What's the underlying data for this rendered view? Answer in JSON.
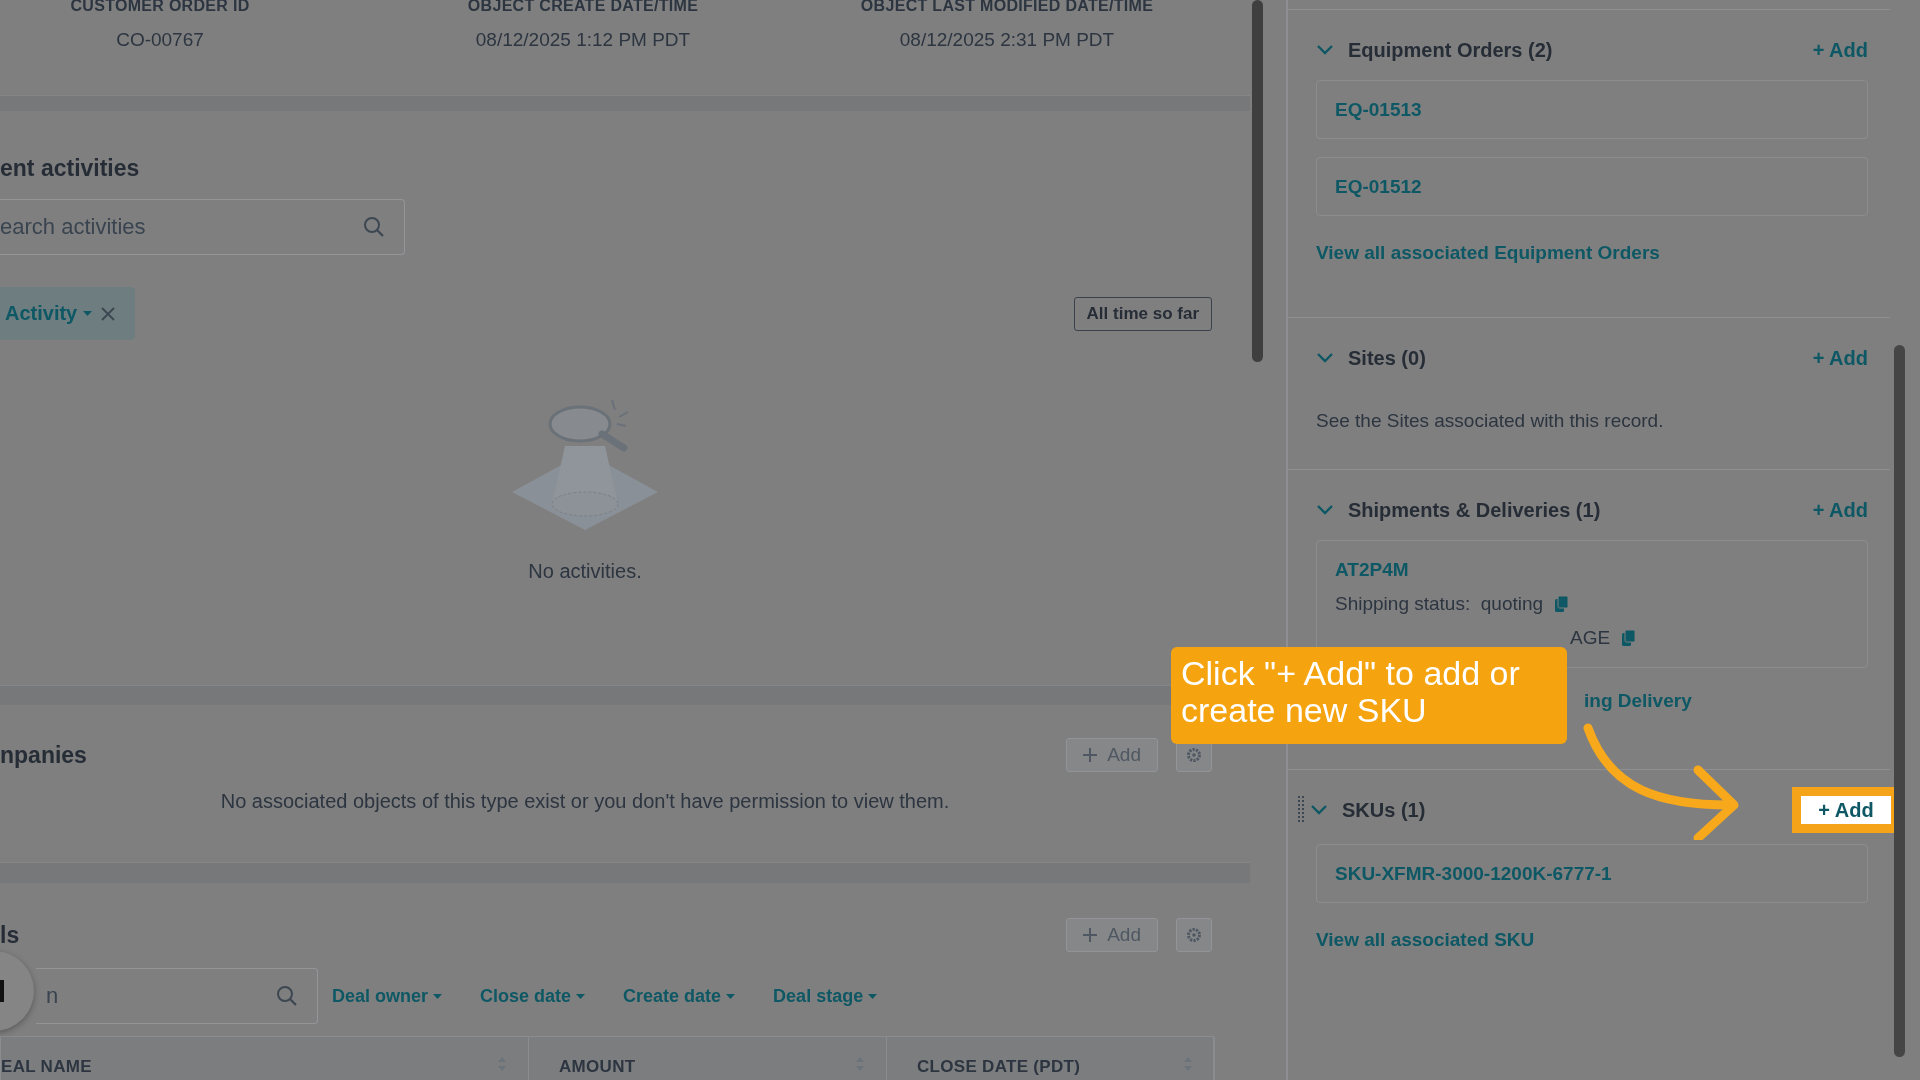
{
  "record_header": {
    "fields": [
      {
        "label": "CUSTOMER ORDER ID",
        "value": "CO-00767"
      },
      {
        "label": "OBJECT CREATE DATE/TIME",
        "value": "08/12/2025 1:12 PM PDT"
      },
      {
        "label": "OBJECT LAST MODIFIED DATE/TIME",
        "value": "08/12/2025 2:31 PM PDT"
      }
    ]
  },
  "activities": {
    "title": "ent activities",
    "search": {
      "placeholder": "earch activities"
    },
    "filter_chip": "Activity",
    "date_range_button": "All time so far",
    "empty_message": "No activities."
  },
  "companies": {
    "title": "npanies",
    "add_button": "Add",
    "empty_message": "No associated objects of this type exist or you don't have permission to view them."
  },
  "deals": {
    "title": "ls",
    "add_button": "Add",
    "search": {
      "placeholder": "n"
    },
    "filters": [
      "Deal owner",
      "Close date",
      "Create date",
      "Deal stage"
    ],
    "columns": [
      "EAL NAME",
      "AMOUNT",
      "CLOSE DATE (PDT)"
    ]
  },
  "sidebar": {
    "sections": [
      {
        "kind": "records",
        "title": "Equipment Orders (2)",
        "add": "+ Add",
        "expanded": true,
        "highlighted": false,
        "records": [
          "EQ-01513",
          "EQ-01512"
        ],
        "view_all": "View all associated Equipment Orders"
      },
      {
        "kind": "text",
        "title": "Sites (0)",
        "add": "+ Add",
        "expanded": true,
        "highlighted": false,
        "description": "See the Sites associated with this record."
      },
      {
        "kind": "shipment",
        "title": "Shipments & Deliveries (1)",
        "add": "+ Add",
        "expanded": true,
        "highlighted": false,
        "card": {
          "id": "AT2P4M",
          "status_label": "Shipping status:",
          "status_value": "quoting",
          "second_value": "AGE"
        },
        "view_all": "ing Delivery"
      },
      {
        "kind": "records",
        "title": "SKUs (1)",
        "add": "+ Add",
        "expanded": true,
        "highlighted": true,
        "draggable": true,
        "records": [
          "SKU-XFMR-3000-1200K-6777-1"
        ],
        "view_all": "View all associated SKU"
      }
    ]
  },
  "callout": {
    "text": "Click \"+ Add\" to add or create new SKU"
  }
}
